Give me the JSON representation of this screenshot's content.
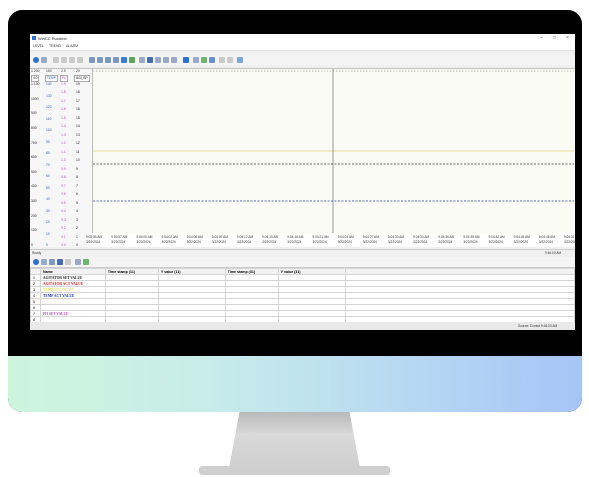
{
  "window": {
    "title": "WinCC Runtime",
    "controls": [
      "–",
      "□",
      "×"
    ],
    "menu": [
      "LEVEL",
      "TREND",
      "ALARM"
    ]
  },
  "axes": [
    {
      "header": "1.200",
      "tag": "4.0",
      "color": "#222222",
      "ticks": [
        "1.100",
        "1000",
        "900",
        "800",
        "700",
        "600",
        "500",
        "400",
        "300",
        "200",
        "100",
        "0"
      ]
    },
    {
      "header": "150",
      "tag": "TEMP",
      "color": "#2a56c9",
      "ticks": [
        "140",
        "130",
        "120",
        "110",
        "100",
        "90",
        "80",
        "70",
        "60",
        "50",
        "40",
        "30",
        "20",
        "10",
        "0"
      ]
    },
    {
      "header": "2.0",
      "tag": "PH",
      "color": "#c244c2",
      "ticks": [
        "1.9",
        "1.8",
        "1.7",
        "1.6",
        "1.5",
        "1.4",
        "1.3",
        "1.2",
        "1.1",
        "1.0",
        "0.9",
        "0.8",
        "0.7",
        "0.6",
        "0.5",
        "0.4",
        "0.3",
        "0.2",
        "0.1",
        "0.0"
      ]
    },
    {
      "header": "20",
      "tag": "AGI_SP",
      "color": "#222222",
      "ticks": [
        "19",
        "18",
        "17",
        "16",
        "15",
        "14",
        "13",
        "12",
        "11",
        "10",
        "9",
        "8",
        "7",
        "6",
        "5",
        "4",
        "3",
        "2",
        "1",
        "0"
      ]
    }
  ],
  "x_axis": {
    "times": [
      "9:03:55 AM",
      "9:03:57 AM",
      "9:04:00 AM",
      "9:04:02 AM",
      "9:04:06 AM",
      "9:04:09 AM",
      "9:04:12 AM",
      "9:04:15 AM",
      "9:04:18 AM",
      "9:04:21 AM",
      "9:04:24 AM",
      "9:04:27 AM",
      "9:04:30 AM",
      "9:04:33 AM",
      "9:04:36 AM",
      "9:04:39 AM",
      "9:04:42 AM",
      "9:04:45 AM",
      "9:04:48 AM",
      "9:04:51 AM"
    ],
    "date": "3/22/2024"
  },
  "status": {
    "left": "Ready",
    "right": "9:46:03 AM"
  },
  "table": {
    "headers": [
      "Name",
      "Time stamp (11)",
      "Y value (11)",
      "Time stamp (31)",
      "Y value (31)"
    ],
    "rows": [
      {
        "num": "1",
        "name": "AGITATOR SET VALUE",
        "color": "#222222"
      },
      {
        "num": "2",
        "name": "AGITATOR ACT VALUE",
        "color": "#d42020"
      },
      {
        "num": "3",
        "name": "TEMP SET VALUE",
        "color": "#e0e060"
      },
      {
        "num": "4",
        "name": "TEMP ACT VALUE",
        "color": "#1f36b8"
      },
      {
        "num": "5",
        "name": "",
        "color": "#222222"
      },
      {
        "num": "6",
        "name": "",
        "color": "#222222"
      },
      {
        "num": "7",
        "name": "PH SET VALUE",
        "color": "#c244c2"
      },
      {
        "num": "8",
        "name": "",
        "color": "#222222"
      }
    ]
  },
  "footer": {
    "right": "Source: Control  9:46:03 AM"
  }
}
